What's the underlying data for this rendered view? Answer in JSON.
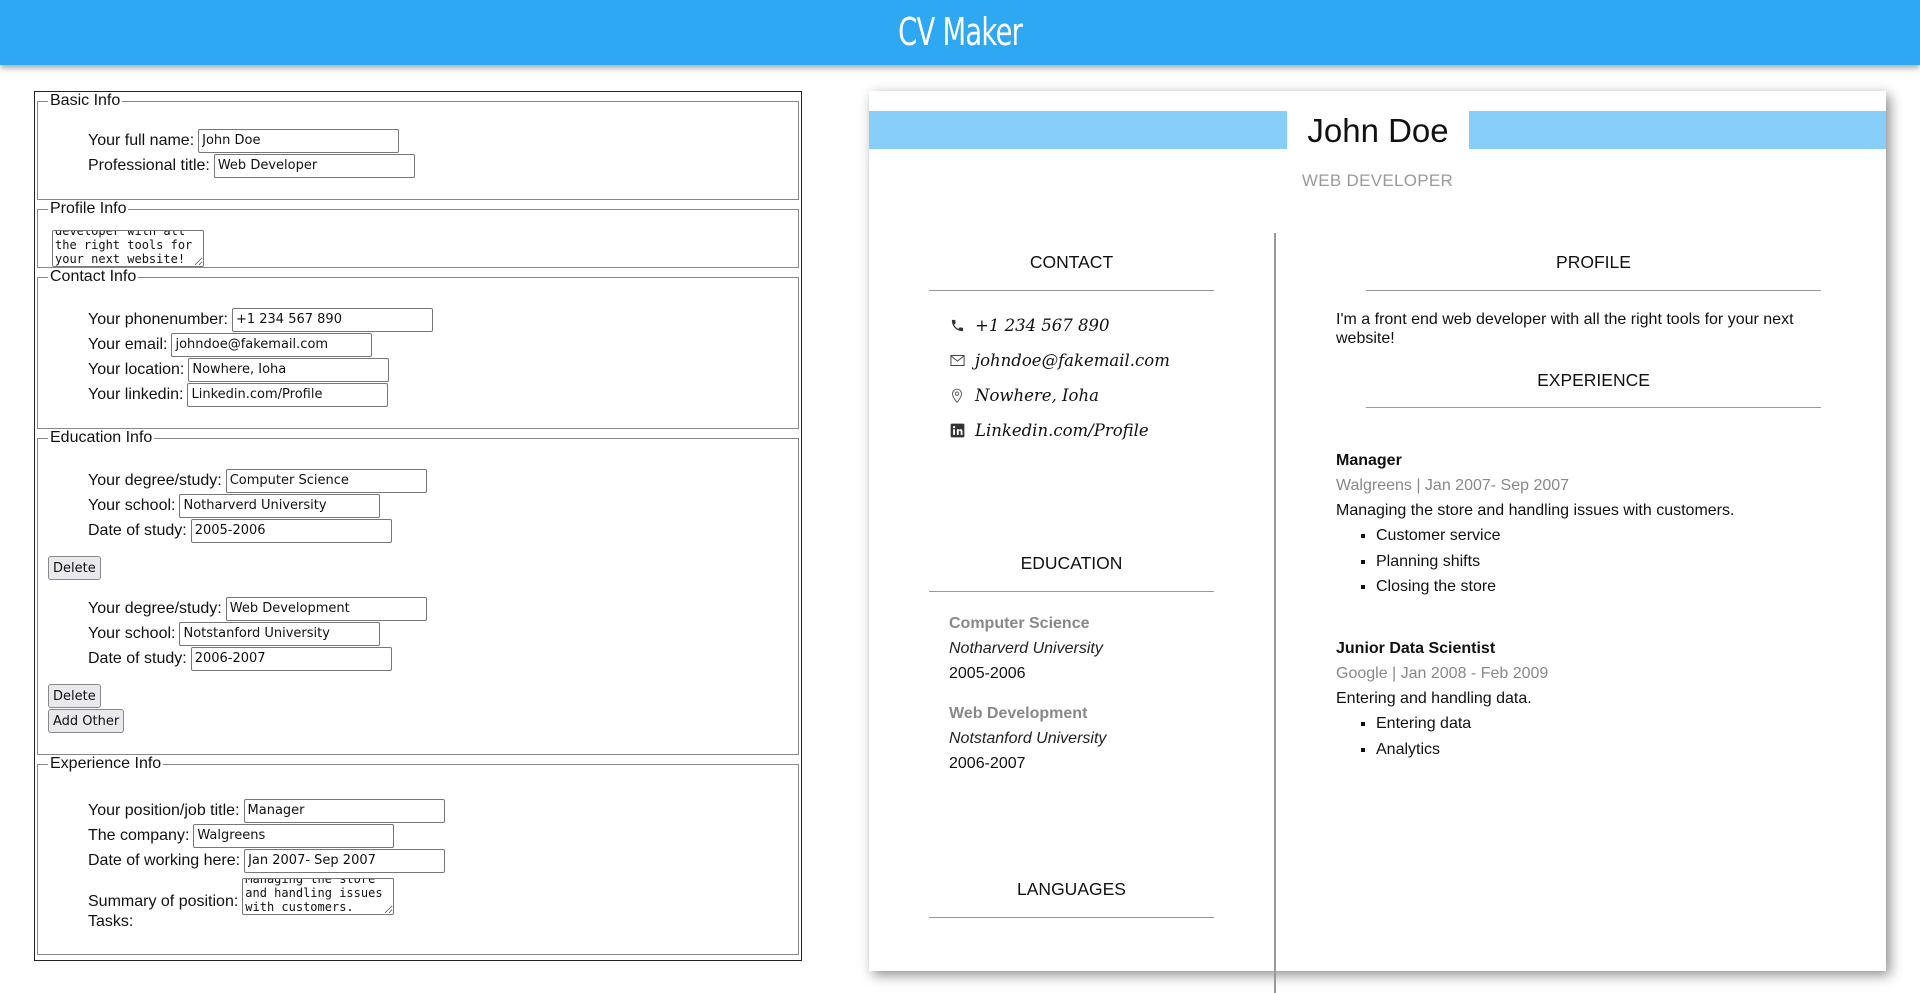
{
  "app": {
    "title": "CV Maker"
  },
  "form": {
    "basic": {
      "legend": "Basic Info",
      "name_label": "Your full name:",
      "name_value": "John Doe",
      "title_label": "Professional title:",
      "title_value": "Web Developer"
    },
    "profile": {
      "legend": "Profile Info",
      "value": "I'm a front end web developer with all the right tools for your next website!"
    },
    "contact": {
      "legend": "Contact Info",
      "phone_label": "Your phonenumber:",
      "phone_value": "+1 234 567 890",
      "email_label": "Your email:",
      "email_value": "johndoe@fakemail.com",
      "location_label": "Your location:",
      "location_value": "Nowhere, Ioha",
      "linkedin_label": "Your linkedin:",
      "linkedin_value": "Linkedin.com/Profile"
    },
    "education": {
      "legend": "Education Info",
      "degree_label": "Your degree/study:",
      "school_label": "Your school:",
      "date_label": "Date of study:",
      "delete_label": "Delete",
      "add_label": "Add Other",
      "entries": [
        {
          "degree": "Computer Science",
          "school": "Notharverd University",
          "date": "2005-2006"
        },
        {
          "degree": "Web Development",
          "school": "Notstanford University",
          "date": "2006-2007"
        }
      ]
    },
    "experience": {
      "legend": "Experience Info",
      "position_label": "Your position/job title:",
      "position_value": "Manager",
      "company_label": "The company:",
      "company_value": "Walgreens",
      "date_label": "Date of working here:",
      "date_value": "Jan 2007- Sep 2007",
      "summary_label": "Summary of position:",
      "summary_value": "Managing the store and handling issues with customers.",
      "tasks_label": "Tasks:"
    }
  },
  "cv": {
    "name": "John Doe",
    "title": "WEB DEVELOPER",
    "contact_heading": "CONTACT",
    "contact": {
      "phone": "+1 234 567 890",
      "email": "johndoe@fakemail.com",
      "location": "Nowhere, Ioha",
      "linkedin": "Linkedin.com/Profile"
    },
    "education_heading": "EDUCATION",
    "education": [
      {
        "degree": "Computer Science",
        "school": "Notharverd University",
        "date": "2005-2006"
      },
      {
        "degree": "Web Development",
        "school": "Notstanford University",
        "date": "2006-2007"
      }
    ],
    "languages_heading": "LANGUAGES",
    "profile_heading": "PROFILE",
    "profile_text": "I'm a front end web developer with all the right tools for your next website!",
    "experience_heading": "EXPERIENCE",
    "jobs": [
      {
        "title": "Manager",
        "meta": "Walgreens | Jan 2007- Sep 2007",
        "summary": "Managing the store and handling issues with customers.",
        "tasks": [
          "Customer service",
          "Planning shifts",
          "Closing the store"
        ]
      },
      {
        "title": "Junior Data Scientist",
        "meta": "Google | Jan 2008 - Feb 2009",
        "summary": "Entering and handling data.",
        "tasks": [
          "Entering data",
          "Analytics"
        ]
      }
    ]
  },
  "colors": {
    "header": "#2ea8f3",
    "band": "#87cefa",
    "muted": "#888888"
  },
  "icons": {
    "phone": "phone-icon",
    "email": "mail-icon",
    "location": "map-pin-icon",
    "linkedin": "linkedin-icon"
  }
}
